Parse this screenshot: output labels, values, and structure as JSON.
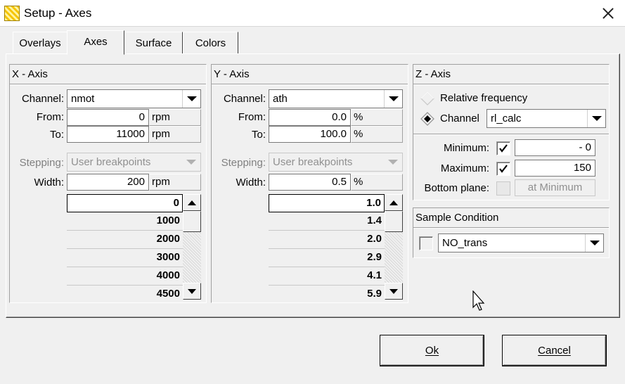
{
  "window": {
    "title": "Setup - Axes"
  },
  "tabs": [
    {
      "label": "Overlays",
      "active": false
    },
    {
      "label": "Axes",
      "active": true
    },
    {
      "label": "Surface",
      "active": false
    },
    {
      "label": "Colors",
      "active": false
    }
  ],
  "x_axis": {
    "title": "X - Axis",
    "channel_label": "Channel:",
    "channel_value": "nmot",
    "from_label": "From:",
    "from_value": "0",
    "from_unit": "rpm",
    "to_label": "To:",
    "to_value": "11000",
    "to_unit": "rpm",
    "stepping_label": "Stepping:",
    "stepping_value": "User breakpoints",
    "width_label": "Width:",
    "width_value": "200",
    "width_unit": "rpm",
    "breakpoints": [
      "0",
      "1000",
      "2000",
      "3000",
      "4000",
      "4500"
    ]
  },
  "y_axis": {
    "title": "Y - Axis",
    "channel_label": "Channel:",
    "channel_value": "ath",
    "from_label": "From:",
    "from_value": "0.0",
    "from_unit": "%",
    "to_label": "To:",
    "to_value": "100.0",
    "to_unit": "%",
    "stepping_label": "Stepping:",
    "stepping_value": "User breakpoints",
    "width_label": "Width:",
    "width_value": "0.5",
    "width_unit": "%",
    "breakpoints": [
      "1.0",
      "1.4",
      "2.0",
      "2.9",
      "4.1",
      "5.9"
    ]
  },
  "z_axis": {
    "title": "Z - Axis",
    "relative_frequency_label": "Relative frequency",
    "channel_label": "Channel",
    "channel_value": "rl_calc",
    "minimum_label": "Minimum:",
    "minimum_value": "- 0",
    "maximum_label": "Maximum:",
    "maximum_value": "150",
    "bottom_plane_label": "Bottom plane:",
    "bottom_plane_value": "at Minimum"
  },
  "sample_condition": {
    "title": "Sample Condition",
    "value": "NO_trans"
  },
  "buttons": {
    "ok_label": "Ok",
    "cancel_label": "Cancel"
  }
}
